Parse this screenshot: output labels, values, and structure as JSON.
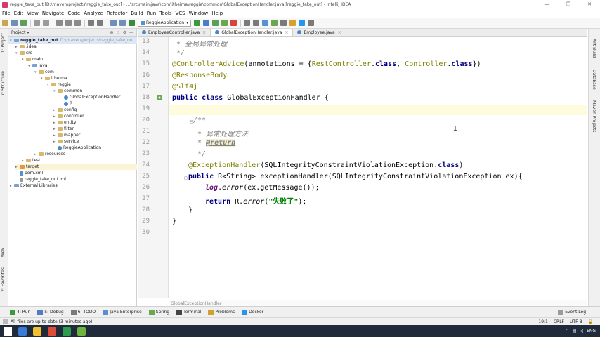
{
  "window": {
    "title": "reggie_take_out [D:\\maven\\projects\\reggie_take_out] - ...\\src\\main\\java\\com\\itheima\\reggie\\common\\GlobalExceptionHandler.java [reggie_take_out] - IntelliJ IDEA",
    "controls": [
      "—",
      "❐",
      "✕"
    ]
  },
  "menu": [
    "File",
    "Edit",
    "View",
    "Navigate",
    "Code",
    "Analyze",
    "Refactor",
    "Build",
    "Run",
    "Tools",
    "VCS",
    "Window",
    "Help"
  ],
  "toolbar": {
    "run_config": "ReggieApplication"
  },
  "left_strip": {
    "project": "1: Project",
    "structure": "7: Structure",
    "web": "Web",
    "favorites": "2: Favorites"
  },
  "project_panel": {
    "title": "Project",
    "header_icons": [
      "⊕",
      "÷",
      "⚙",
      "—"
    ],
    "root": {
      "name": "reggie_take_out",
      "path": "D:\\maven\\projects\\reggie_take_out"
    },
    "tree": [
      {
        "label": ".idea"
      },
      {
        "label": "src"
      },
      {
        "label": "main"
      },
      {
        "label": "java"
      },
      {
        "label": "com"
      },
      {
        "label": "itheima"
      },
      {
        "label": "reggie"
      },
      {
        "label": "common"
      },
      {
        "label": "GlobalExceptionHandler"
      },
      {
        "label": "R"
      },
      {
        "label": "config"
      },
      {
        "label": "controller"
      },
      {
        "label": "entity"
      },
      {
        "label": "filter"
      },
      {
        "label": "mapper"
      },
      {
        "label": "service"
      },
      {
        "label": "ReggieApplication"
      },
      {
        "label": "resources"
      },
      {
        "label": "test"
      },
      {
        "label": "target"
      },
      {
        "label": "pom.xml"
      },
      {
        "label": "reggie_take_out.iml"
      },
      {
        "label": "External Libraries"
      }
    ]
  },
  "editor": {
    "tabs": [
      {
        "label": "EmployeeController.java"
      },
      {
        "label": "GlobalExceptionHandler.java"
      },
      {
        "label": "Employee.java"
      }
    ],
    "line_numbers": [
      "13",
      "14",
      "15",
      "16",
      "17",
      "18",
      "19",
      "20",
      "21",
      "22",
      "23",
      "24",
      "25",
      "26",
      "27",
      "28",
      "29",
      "30"
    ],
    "code": {
      "l13_comment": " * 全局异常处理",
      "l14_comment": " */",
      "l15_anno": "@ControllerAdvice",
      "l15_open": "(annotations = {",
      "l15_c1": "RestController",
      "l15_dot1": ".",
      "l15_kw1": "class",
      "l15_comma": ", ",
      "l15_c2": "Controller",
      "l15_dot2": ".",
      "l15_kw2": "class",
      "l15_close": "})",
      "l16_anno": "@ResponseBody",
      "l17_anno": "@Slf4j",
      "l18_kw": "public class",
      "l18_rest": " GlobalExceptionHandler {",
      "l20_comment": "/**",
      "l21_comment": " * 异常处理方法",
      "l22_star": " * ",
      "l22_tag": "@return",
      "l23_comment": " */",
      "l24_anno": "@ExceptionHandler",
      "l24_open": "(SQLIntegrityConstraintViolationException.",
      "l24_kw": "class",
      "l24_close": ")",
      "l25_kw": "public",
      "l25_rest": " R<String> exceptionHandler(SQLIntegrityConstraintViolationException ex){",
      "l26_field": "log",
      "l26_dot": ".",
      "l26_method": "error",
      "l26_rest": "(ex.getMessage());",
      "l27_kw": "return",
      "l27_r": " R.",
      "l27_method": "error",
      "l27_open": "(",
      "l27_str": "\"失败了\"",
      "l27_close": ");",
      "l28": "}",
      "l29": "}"
    },
    "breadcrumb": "GlobalExceptionHandler"
  },
  "right_strip": {
    "ant_build": "Ant Build",
    "database": "Database",
    "maven": "Maven Projects"
  },
  "bottom_tools": [
    {
      "label": "4: Run",
      "color": "#3c9a3c"
    },
    {
      "label": "5: Debug",
      "color": "#4f7cc4"
    },
    {
      "label": "6: TODO",
      "color": "#7a7a7a"
    },
    {
      "label": "Java Enterprise",
      "color": "#5a8fd1"
    },
    {
      "label": "Spring",
      "color": "#6aa84f"
    },
    {
      "label": "Terminal",
      "color": "#444444"
    },
    {
      "label": "Problems",
      "color": "#d0a030"
    },
    {
      "label": "Docker",
      "color": "#2496ed"
    }
  ],
  "event_log": "Event Log",
  "status": {
    "message": "All files are up-to-date (3 minutes ago)",
    "position": "19:1",
    "line_sep": "CRLF",
    "encoding": "UTF-8"
  },
  "taskbar": {
    "app_colors": [
      "#3a7bd5",
      "#f0c030",
      "#dd4b39",
      "#2d9c4c",
      "#6cb33f"
    ],
    "lang": "ENG"
  }
}
